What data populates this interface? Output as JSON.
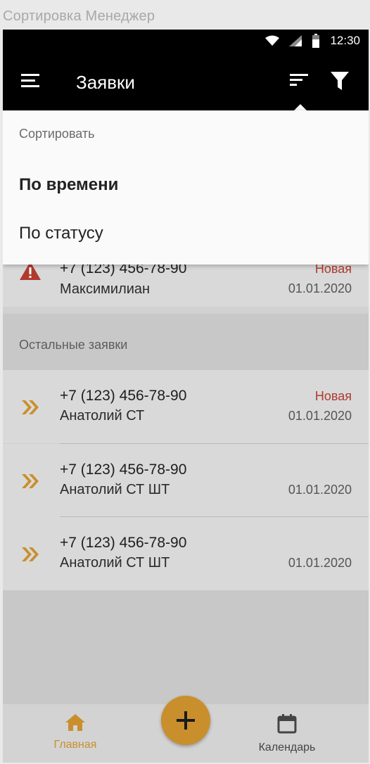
{
  "window": {
    "title": "Сортировка Менеджер"
  },
  "status_bar": {
    "time": "12:30"
  },
  "app_bar": {
    "title": "Заявки",
    "menu_icon": "menu-icon",
    "sort_icon": "sort-icon",
    "filter_icon": "filter-icon"
  },
  "sort_menu": {
    "header": "Сортировать",
    "options": [
      {
        "label": "По времени",
        "selected": true
      },
      {
        "label": "По статусу",
        "selected": false
      }
    ]
  },
  "urgent_items": [
    {
      "phone": "+7 (123) 456-78-90",
      "name": "Максимилиан",
      "status": "Новая",
      "date": "01.01.2020",
      "icon": "warning-icon"
    }
  ],
  "other_section": {
    "title": "Остальные заявки"
  },
  "other_items": [
    {
      "phone": "+7 (123) 456-78-90",
      "name": "Анатолий СТ",
      "status": "Новая",
      "date": "01.01.2020",
      "icon": "double-chevron-icon"
    },
    {
      "phone": "+7 (123) 456-78-90",
      "name": "Анатолий СТ ШТ",
      "status": "",
      "date": "01.01.2020",
      "icon": "double-chevron-icon"
    },
    {
      "phone": "+7 (123) 456-78-90",
      "name": "Анатолий СТ ШТ",
      "status": "",
      "date": "01.01.2020",
      "icon": "double-chevron-icon"
    }
  ],
  "bottom_nav": {
    "home_label": "Главная",
    "calendar_label": "Календарь",
    "fab_icon": "plus-icon"
  },
  "colors": {
    "accent": "#c98f2d",
    "status_new": "#b03a2e",
    "bar": "#000000"
  }
}
